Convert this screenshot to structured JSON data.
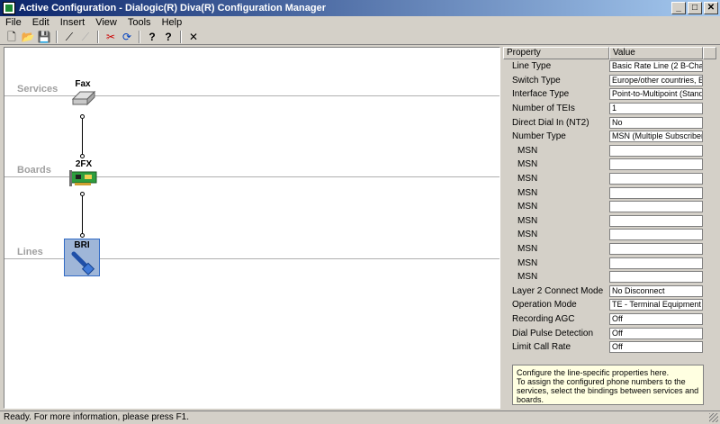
{
  "window": {
    "title": "Active Configuration - Dialogic(R) Diva(R) Configuration Manager",
    "buttons": [
      "_",
      "□",
      "✕"
    ]
  },
  "menu": [
    "File",
    "Edit",
    "Insert",
    "View",
    "Tools",
    "Help"
  ],
  "toolbar": [
    {
      "name": "new-icon",
      "glyph": "🗋"
    },
    {
      "name": "open-icon",
      "glyph": "📂"
    },
    {
      "name": "save-icon",
      "glyph": "💾"
    },
    {
      "name": "connect-icon",
      "glyph": "⟋"
    },
    {
      "name": "disconnect-icon",
      "glyph": "⟋"
    },
    {
      "name": "cut-icon",
      "glyph": "✂"
    },
    {
      "name": "activate-icon",
      "glyph": "⟳"
    },
    {
      "name": "help-icon",
      "glyph": "?"
    },
    {
      "name": "context-help-icon",
      "glyph": "?"
    },
    {
      "name": "delete-icon",
      "glyph": "✕"
    }
  ],
  "canvas": {
    "lanes": [
      "Services",
      "Boards",
      "Lines"
    ],
    "nodes": {
      "service": "Fax",
      "board": "2FX",
      "line": "BRI"
    }
  },
  "properties": {
    "header": {
      "property": "Property",
      "value": "Value"
    },
    "rows": [
      {
        "name": "Line Type",
        "value": "Basic Rate Line (2 B-Chan...",
        "sub": false
      },
      {
        "name": "Switch Type",
        "value": "Europe/other countries, E...",
        "sub": false
      },
      {
        "name": "Interface Type",
        "value": "Point-to-Multipoint (Stand...",
        "sub": false
      },
      {
        "name": "Number of TEIs",
        "value": "1",
        "sub": false
      },
      {
        "name": "Direct Dial In (NT2)",
        "value": "No",
        "sub": false
      },
      {
        "name": "Number Type",
        "value": "MSN (Multiple Subscriber ...",
        "sub": false
      },
      {
        "name": "MSN",
        "value": "",
        "sub": true
      },
      {
        "name": "MSN",
        "value": "",
        "sub": true
      },
      {
        "name": "MSN",
        "value": "",
        "sub": true
      },
      {
        "name": "MSN",
        "value": "",
        "sub": true
      },
      {
        "name": "MSN",
        "value": "",
        "sub": true
      },
      {
        "name": "MSN",
        "value": "",
        "sub": true
      },
      {
        "name": "MSN",
        "value": "",
        "sub": true
      },
      {
        "name": "MSN",
        "value": "",
        "sub": true
      },
      {
        "name": "MSN",
        "value": "",
        "sub": true
      },
      {
        "name": "MSN",
        "value": "",
        "sub": true
      },
      {
        "name": "Layer 2 Connect Mode",
        "value": "No Disconnect",
        "sub": false
      },
      {
        "name": "Operation Mode",
        "value": "TE - Terminal Equipment (...",
        "sub": false
      },
      {
        "name": "Recording AGC",
        "value": "Off",
        "sub": false
      },
      {
        "name": "Dial Pulse Detection",
        "value": "Off",
        "sub": false
      },
      {
        "name": "Limit Call Rate",
        "value": "Off",
        "sub": false
      }
    ],
    "help": "Configure the line-specific properties here.\nTo assign the configured phone numbers to the services, select the bindings between services and boards."
  },
  "status": "Ready.  For more information, please press F1."
}
